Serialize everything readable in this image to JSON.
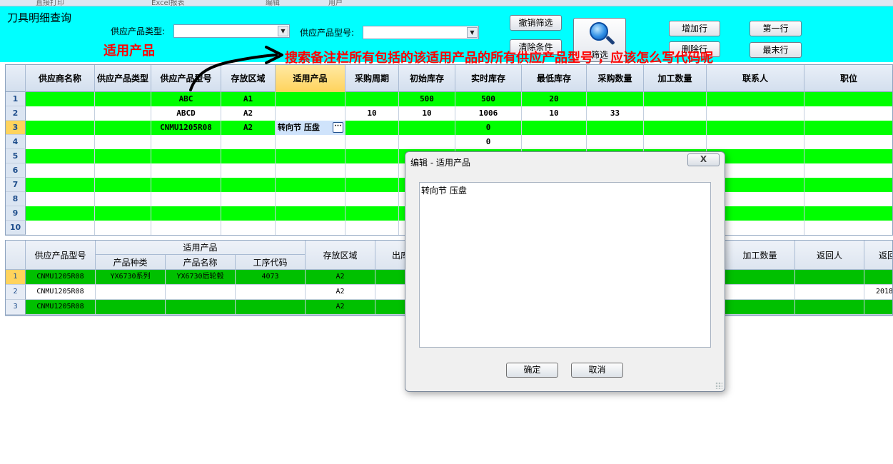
{
  "top_strip": {
    "items": [
      "直接打印",
      "Excel报表",
      "编辑",
      "用户"
    ]
  },
  "header": {
    "title": "刀具明细查询",
    "product_type_label": "供应产品类型:",
    "product_type_value": "",
    "product_model_label": "供应产品型号:",
    "product_model_value": "",
    "cancel_filter_label": "撤销筛选",
    "clear_conditions_label": "清除条件",
    "search_label": "筛选",
    "add_row_label": "增加行",
    "delete_row_label": "删除行",
    "first_row_label": "第一行",
    "last_row_label": "最末行"
  },
  "annotation": {
    "left_note": "适用产品",
    "question": "搜索备注栏所有包括的该适用产品的所有供应产品型号 ，应该怎么写代码呢"
  },
  "colors": {
    "header_bg": "#00ffff",
    "row_green": "#00ff00",
    "lower_row_green": "#00c000",
    "active_header": "#ffd35c",
    "annotation_red": "#ff0000"
  },
  "upper_grid": {
    "columns": [
      "供应商名称",
      "供应产品类型",
      "供应产品型号",
      "存放区域",
      "适用产品",
      "采购周期",
      "初始库存",
      "实时库存",
      "最低库存",
      "采购数量",
      "加工数量",
      "联系人",
      "职位"
    ],
    "rows": [
      {
        "num": "1",
        "cells": [
          "",
          "",
          "ABC",
          "A1",
          "",
          "",
          "500",
          "500",
          "20",
          "",
          "",
          "",
          ""
        ]
      },
      {
        "num": "2",
        "cells": [
          "",
          "",
          "ABCD",
          "A2",
          "",
          "10",
          "10",
          "1006",
          "10",
          "33",
          "",
          "",
          ""
        ]
      },
      {
        "num": "3",
        "cells": [
          "",
          "",
          "CNMU1205R08",
          "A2",
          "转向节 压盘",
          "",
          "",
          "0",
          "",
          "",
          "",
          "",
          ""
        ]
      },
      {
        "num": "4",
        "cells": [
          "",
          "",
          "",
          "",
          "",
          "",
          "",
          "0",
          "",
          "",
          "",
          "",
          ""
        ]
      },
      {
        "num": "5",
        "cells": [
          "",
          "",
          "",
          "",
          "",
          "",
          "",
          "",
          "",
          "",
          "",
          "",
          ""
        ]
      },
      {
        "num": "6",
        "cells": [
          "",
          "",
          "",
          "",
          "",
          "",
          "",
          "",
          "",
          "",
          "",
          "",
          ""
        ]
      },
      {
        "num": "7",
        "cells": [
          "",
          "",
          "",
          "",
          "",
          "",
          "",
          "",
          "",
          "",
          "",
          "",
          ""
        ]
      },
      {
        "num": "8",
        "cells": [
          "",
          "",
          "",
          "",
          "",
          "",
          "",
          "",
          "",
          "",
          "",
          "",
          ""
        ]
      },
      {
        "num": "9",
        "cells": [
          "",
          "",
          "",
          "",
          "",
          "",
          "",
          "",
          "",
          "",
          "",
          "",
          ""
        ]
      },
      {
        "num": "10",
        "cells": [
          "",
          "",
          "",
          "",
          "",
          "",
          "",
          "",
          "",
          "",
          "",
          "",
          ""
        ]
      }
    ],
    "ellipsis": "···"
  },
  "lower_grid": {
    "group_header": "适用产品",
    "columns": {
      "model": "供应产品型号",
      "category": "产品种类",
      "product_name": "产品名称",
      "process_code": "工序代码",
      "storage": "存放区域",
      "outbound": "出库",
      "processing_qty": "加工数量",
      "returner": "返回人",
      "return_date": "返回"
    },
    "rows": [
      {
        "num": "1",
        "model": "CNMU1205R08",
        "category": "YX6730系列",
        "product_name": "YX6730后轮毂",
        "process_code": "4073",
        "storage": "A2",
        "return_date": ""
      },
      {
        "num": "2",
        "model": "CNMU1205R08",
        "category": "",
        "product_name": "",
        "process_code": "",
        "storage": "A2",
        "return_date": "2018"
      },
      {
        "num": "3",
        "model": "CNMU1205R08",
        "category": "",
        "product_name": "",
        "process_code": "",
        "storage": "A2",
        "return_date": ""
      }
    ]
  },
  "dialog": {
    "title": "编辑 - 适用产品",
    "close": "X",
    "text": "转向节 压盘",
    "ok_label": "确定",
    "cancel_label": "取消"
  }
}
